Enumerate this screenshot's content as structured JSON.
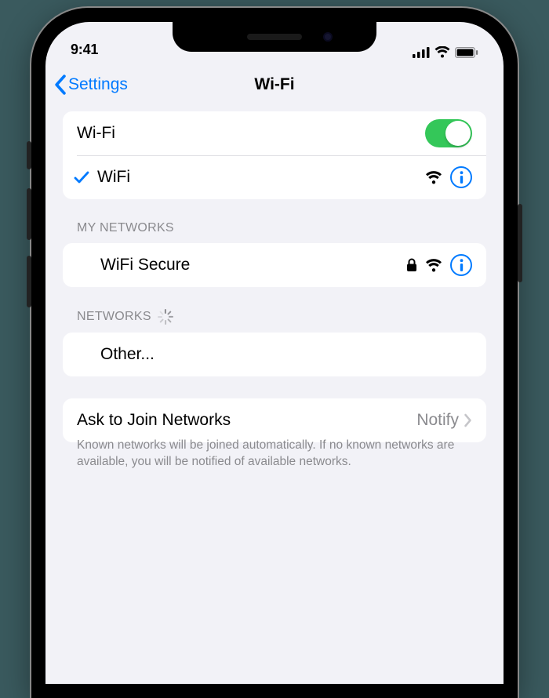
{
  "status": {
    "time": "9:41"
  },
  "nav": {
    "back": "Settings",
    "title": "Wi-Fi"
  },
  "wifi": {
    "toggle_label": "Wi-Fi",
    "toggle_on": true,
    "connected_name": "WiFi"
  },
  "sections": {
    "my_networks": {
      "header": "MY NETWORKS",
      "items": [
        {
          "name": "WiFi Secure",
          "secure": true
        }
      ]
    },
    "networks": {
      "header": "NETWORKS",
      "other_label": "Other..."
    }
  },
  "ask_to_join": {
    "label": "Ask to Join Networks",
    "value": "Notify"
  },
  "footer": "Known networks will be joined automatically. If no known networks are available, you will be notified of available networks."
}
